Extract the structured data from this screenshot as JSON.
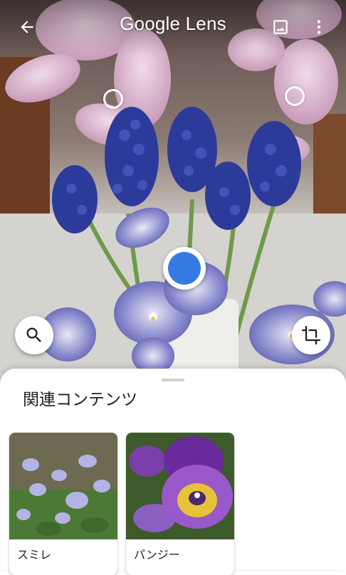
{
  "header": {
    "title_brand": "Google",
    "title_product": "Lens",
    "back_icon": "arrow-back-icon",
    "gallery_icon": "image-icon",
    "more_icon": "more-vert-icon"
  },
  "camera": {
    "subject": "flowers",
    "hotspots": 2,
    "selected_accent": "#3679e0"
  },
  "actions": {
    "search_icon": "search-icon",
    "crop_icon": "crop-icon"
  },
  "results": {
    "title": "関連コンテンツ",
    "items": [
      {
        "label": "スミレ"
      },
      {
        "label": "パンジー"
      }
    ]
  }
}
